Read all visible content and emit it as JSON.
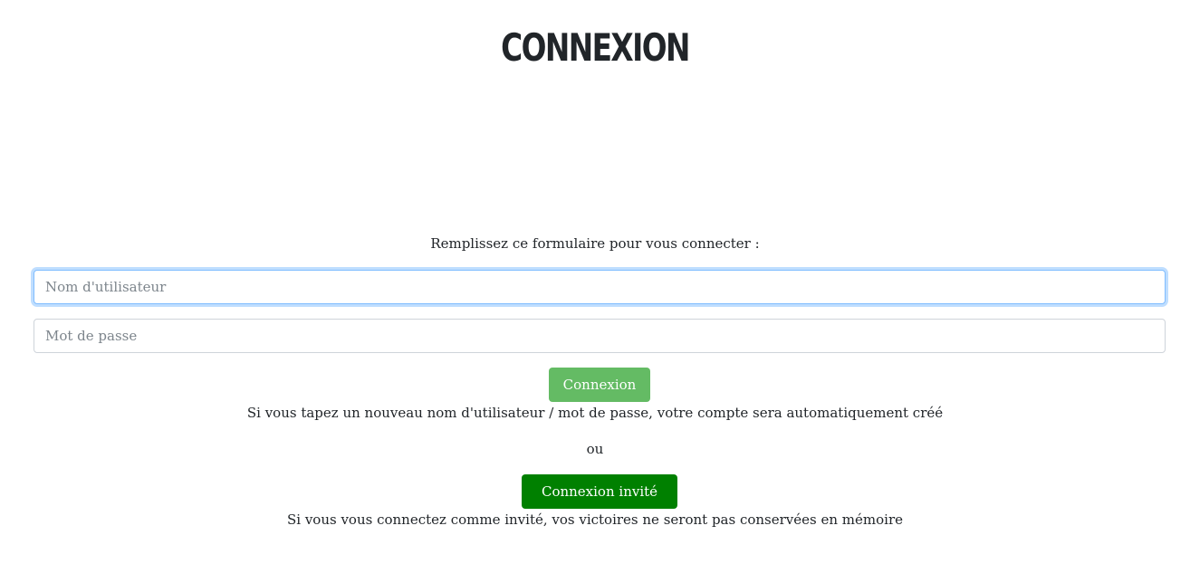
{
  "header": {
    "title": "CONNEXION"
  },
  "form": {
    "instructions": "Remplissez ce formulaire pour vous connecter :",
    "username": {
      "placeholder": "Nom d'utilisateur",
      "value": ""
    },
    "password": {
      "placeholder": "Mot de passe",
      "value": ""
    },
    "login_button": "Connexion",
    "new_account_note": "Si vous tapez un nouveau nom d'utilisateur / mot de passe, votre compte sera automatiquement créé",
    "or_label": "ou",
    "guest_button": "Connexion invité",
    "guest_note": "Si vous vous connectez comme invité, vos victoires ne seront pas conservées en mémoire"
  },
  "colors": {
    "login_button": "#5cb85c",
    "guest_button": "#008000",
    "focus_border": "#80bdff"
  }
}
